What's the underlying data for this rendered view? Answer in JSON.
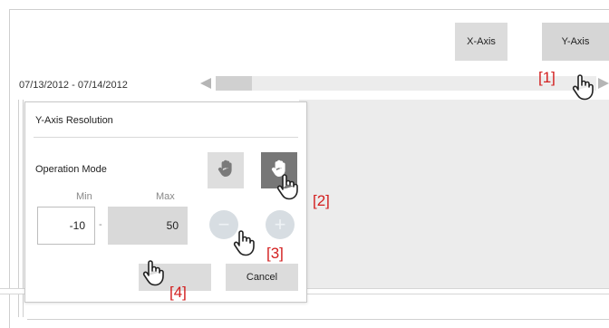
{
  "toolbar": {
    "xaxis_label": "X-Axis",
    "yaxis_label": "Y-Axis"
  },
  "range": {
    "label": "07/13/2012 - 07/14/2012"
  },
  "dialog": {
    "title": "Y-Axis Resolution",
    "operation_mode_label": "Operation Mode",
    "min_header": "Min",
    "max_header": "Max",
    "min_value": "-10",
    "max_value": "50",
    "range_separator": "-",
    "minus_symbol": "−",
    "plus_symbol": "+",
    "ok_label": "",
    "cancel_label": "Cancel",
    "mode_pan_icon": "hand-icon",
    "mode_zoom_icon": "hand-icon",
    "active_mode": "zoom"
  },
  "steps": {
    "s1": "[1]",
    "s2": "[2]",
    "s3": "[3]",
    "s4": "[4]"
  },
  "colors": {
    "step_annotation": "#d32020",
    "active_mode": "#777777",
    "button": "#dcdcdc"
  }
}
